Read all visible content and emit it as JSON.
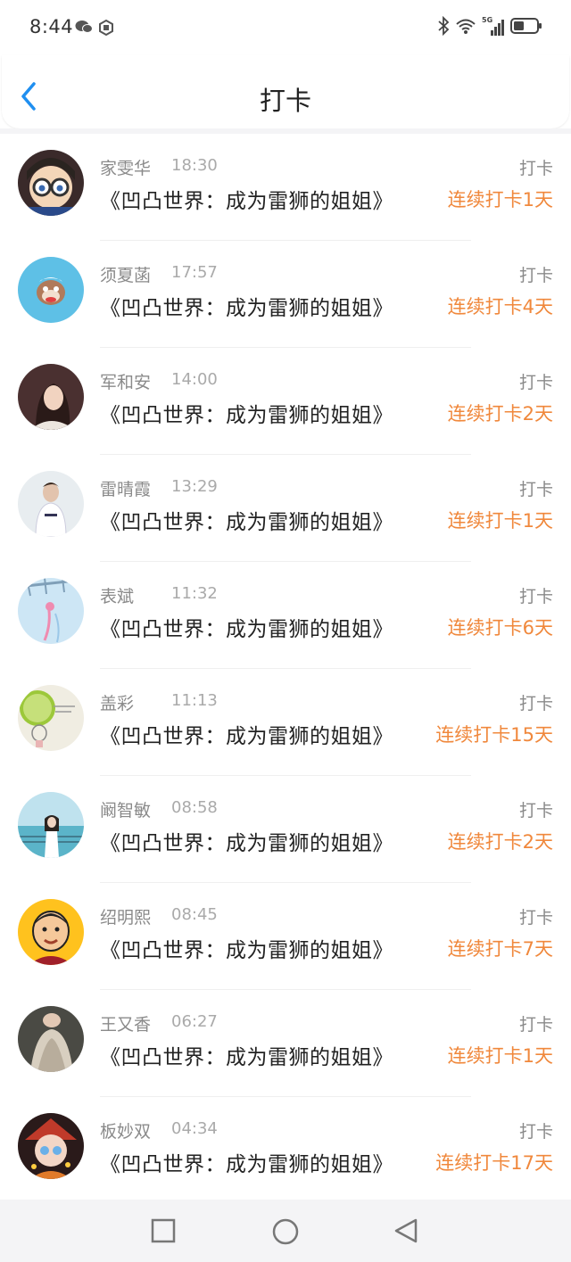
{
  "status_bar": {
    "time": "8:44",
    "icons": [
      "wechat-icon",
      "app-icon",
      "bluetooth-icon",
      "wifi-icon",
      "signal-5g-icon",
      "battery-icon"
    ],
    "network_label": "5G"
  },
  "header": {
    "title": "打卡",
    "back_icon": "chevron-left-icon"
  },
  "colors": {
    "accent_blue": "#1f8ff0",
    "streak_orange": "#f0883c",
    "secondary_text": "#8a8a8a"
  },
  "items": [
    {
      "name": "家雯华",
      "time": "18:30",
      "type": "打卡",
      "book": "《凹凸世界：成为雷狮的姐姐》",
      "streak": "连续打卡1天"
    },
    {
      "name": "须夏菡",
      "time": "17:57",
      "type": "打卡",
      "book": "《凹凸世界：成为雷狮的姐姐》",
      "streak": "连续打卡4天"
    },
    {
      "name": "军和安",
      "time": "14:00",
      "type": "打卡",
      "book": "《凹凸世界：成为雷狮的姐姐》",
      "streak": "连续打卡2天"
    },
    {
      "name": "雷晴霞",
      "time": "13:29",
      "type": "打卡",
      "book": "《凹凸世界：成为雷狮的姐姐》",
      "streak": "连续打卡1天"
    },
    {
      "name": "表斌",
      "time": "11:32",
      "type": "打卡",
      "book": "《凹凸世界：成为雷狮的姐姐》",
      "streak": "连续打卡6天"
    },
    {
      "name": "盖彩",
      "time": "11:13",
      "type": "打卡",
      "book": "《凹凸世界：成为雷狮的姐姐》",
      "streak": "连续打卡15天"
    },
    {
      "name": "阚智敏",
      "time": "08:58",
      "type": "打卡",
      "book": "《凹凸世界：成为雷狮的姐姐》",
      "streak": "连续打卡2天"
    },
    {
      "name": "绍明熙",
      "time": "08:45",
      "type": "打卡",
      "book": "《凹凸世界：成为雷狮的姐姐》",
      "streak": "连续打卡7天"
    },
    {
      "name": "王又香",
      "time": "06:27",
      "type": "打卡",
      "book": "《凹凸世界：成为雷狮的姐姐》",
      "streak": "连续打卡1天"
    },
    {
      "name": "板妙双",
      "time": "04:34",
      "type": "打卡",
      "book": "《凹凸世界：成为雷狮的姐姐》",
      "streak": "连续打卡17天"
    }
  ],
  "nav_bar": {
    "buttons": [
      "recents-square-icon",
      "home-circle-icon",
      "back-triangle-icon"
    ]
  }
}
